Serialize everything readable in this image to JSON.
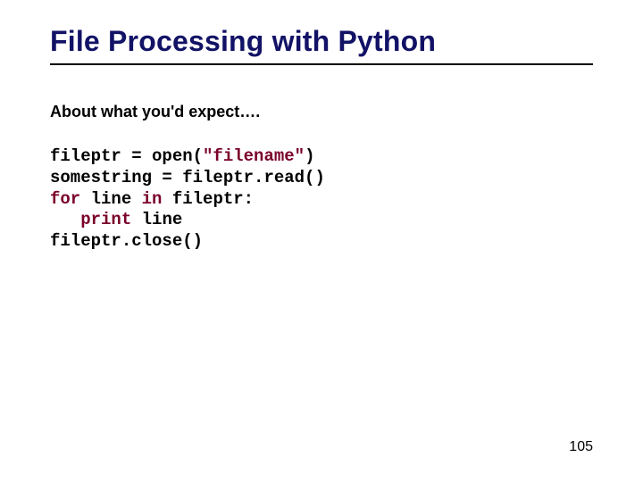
{
  "slide": {
    "title": "File Processing with Python",
    "subtitle": "About what you'd expect….",
    "page_number": "105",
    "code": {
      "l1a": "fileptr = open(",
      "l1b": "\"filename\"",
      "l1c": ")",
      "l2": "somestring = fileptr.read()",
      "l3a": "for",
      "l3b": " line ",
      "l3c": "in",
      "l3d": " fileptr:",
      "l4a": "   ",
      "l4b": "print",
      "l4c": " line",
      "l5": "fileptr.close()"
    }
  }
}
